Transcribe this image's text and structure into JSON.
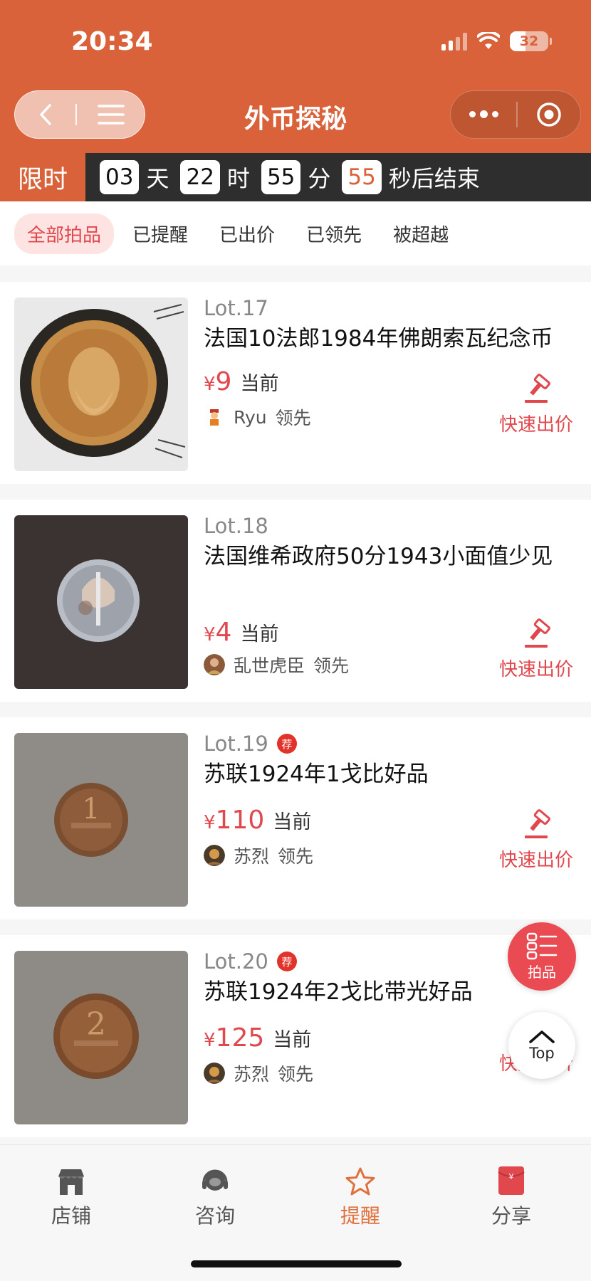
{
  "status": {
    "time": "20:34",
    "battery": "32"
  },
  "nav": {
    "title": "外币探秘"
  },
  "countdown": {
    "label": "限时",
    "days": "03",
    "days_unit": "天",
    "hours": "22",
    "hours_unit": "时",
    "minutes": "55",
    "minutes_unit": "分",
    "seconds": "55",
    "suffix": "秒后结束"
  },
  "filters": [
    "全部拍品",
    "已提醒",
    "已出价",
    "已领先",
    "被超越"
  ],
  "items": [
    {
      "lot": "Lot.17",
      "title": "法国10法郎1984年佛朗索瓦纪念币",
      "currency": "¥",
      "price": "9",
      "price_label": "当前",
      "leader": "Ryu",
      "leader_label": "领先",
      "action": "快速出价",
      "recommended": false
    },
    {
      "lot": "Lot.18",
      "title": "法国维希政府50分1943小面值少见",
      "currency": "¥",
      "price": "4",
      "price_label": "当前",
      "leader": "乱世虎臣",
      "leader_label": "领先",
      "action": "快速出价",
      "recommended": false
    },
    {
      "lot": "Lot.19",
      "rec_label": "荐",
      "title": "苏联1924年1戈比好品",
      "currency": "¥",
      "price": "110",
      "price_label": "当前",
      "leader": "苏烈",
      "leader_label": "领先",
      "action": "快速出价",
      "recommended": true
    },
    {
      "lot": "Lot.20",
      "rec_label": "荐",
      "title": "苏联1924年2戈比带光好品",
      "currency": "¥",
      "price": "125",
      "price_label": "当前",
      "leader": "苏烈",
      "leader_label": "领先",
      "action": "快速出价",
      "recommended": true
    }
  ],
  "floating": {
    "auction_label": "拍品",
    "top_label": "Top"
  },
  "tabbar": [
    {
      "label": "店铺",
      "icon": "store-icon"
    },
    {
      "label": "咨询",
      "icon": "headset-icon"
    },
    {
      "label": "提醒",
      "icon": "star-icon",
      "active": true
    },
    {
      "label": "分享",
      "icon": "red-envelope-icon"
    }
  ],
  "colors": {
    "header": "#d9623a",
    "accent_red": "#e0484e",
    "active_tab": "#e0703e"
  }
}
